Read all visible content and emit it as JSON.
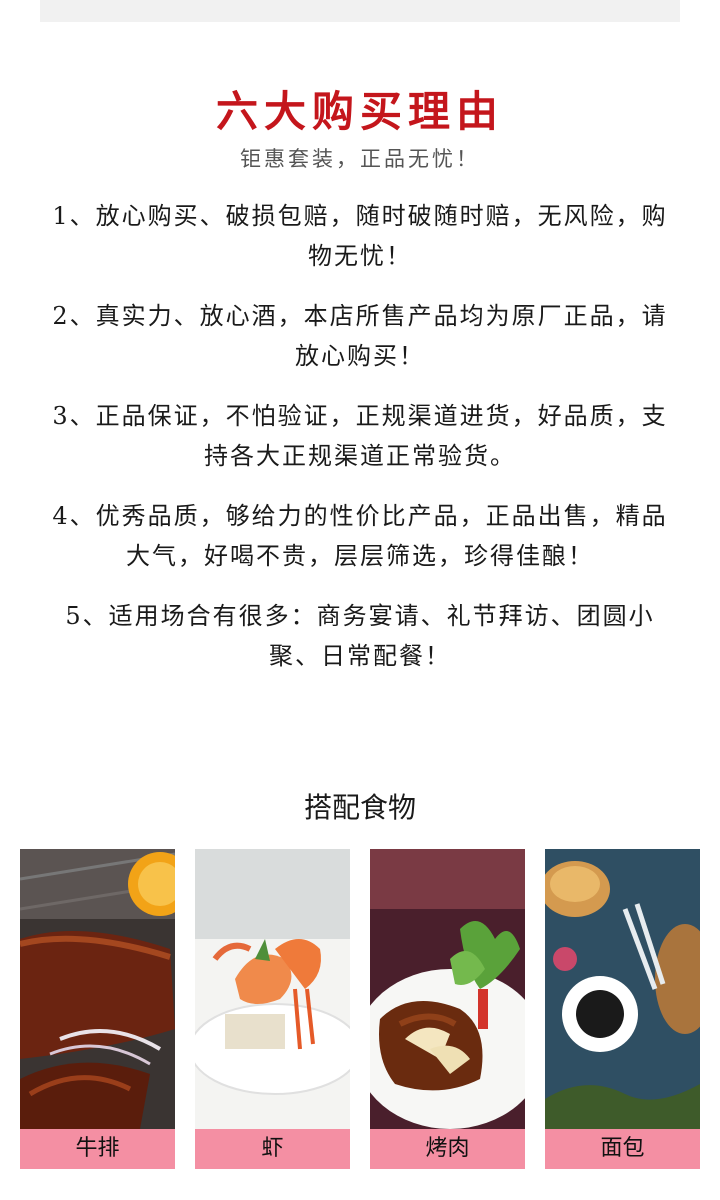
{
  "headline": "六大购买理由",
  "subhead": "钜惠套装，正品无忧！",
  "reasons": [
    "1、放心购买、破损包赔，随时破随时赔，无风险，购物无忧！",
    "2、真实力、放心酒，本店所售产品均为原厂正品，请放心购买！",
    "3、正品保证，不怕验证，正规渠道进货，好品质，支持各大正规渠道正常验货。",
    "4、优秀品质，够给力的性价比产品，正品出售，精品大气，好喝不贵，层层筛选，珍得佳酿！",
    "5、适用场合有很多：商务宴请、礼节拜访、团圆小聚、日常配餐！"
  ],
  "pairing": {
    "title": "搭配食物",
    "items": [
      {
        "label": "牛排",
        "icon": "steak-photo"
      },
      {
        "label": "虾",
        "icon": "shrimp-photo"
      },
      {
        "label": "烤肉",
        "icon": "roast-meat-photo"
      },
      {
        "label": "面包",
        "icon": "bread-photo"
      }
    ]
  },
  "colors": {
    "headline": "#c4161c",
    "label_bg": "#f48fa3",
    "top_bar": "#f1f1f1"
  }
}
